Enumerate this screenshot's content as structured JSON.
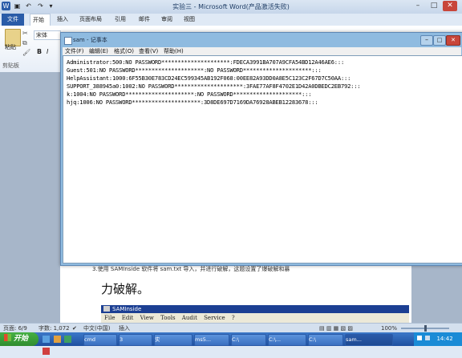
{
  "word": {
    "title": "实验三 - Microsoft Word(产品激活失败)",
    "tabs": [
      "文件",
      "开始",
      "插入",
      "页面布局",
      "引用",
      "邮件",
      "审阅",
      "视图"
    ],
    "clipboard": {
      "paste": "粘贴",
      "group": "剪贴板"
    },
    "font_name": "宋体",
    "format_buttons": [
      "B",
      "I"
    ],
    "doc_line": "3.使用 SAMInside 软件将 sam.txt 导入，并进行破解，这题设置了爆破解和暴",
    "doc_heading": "力破解。",
    "saminside": {
      "title": "SAMInside",
      "menu": [
        "File",
        "Edit",
        "View",
        "Tools",
        "Audit",
        "Service",
        "?"
      ]
    }
  },
  "notepad": {
    "title": "sam - 记事本",
    "menu": [
      "文件(F)",
      "编辑(E)",
      "格式(O)",
      "查看(V)",
      "帮助(H)"
    ],
    "lines": [
      "Administrator:500:NO PASSWORD*********************:FDECA3991BA707A9CFA54BD12A46AE6:::",
      "Guest:501:NO PASSWORD*********************:NO PASSWORD*********************:::",
      "HelpAssistant:1000:6F55B30E783CD24EC599345AB192F068:00EE82A93DD0A8E5C123C2F67D7C50AA:::",
      "SUPPORT_388945a0:1002:NO PASSWORD*********************:3FAE77AF8F4702E1D42A0DBEDC2EB792:::",
      "k:1004:NO PASSWORD*********************:NO PASSWORD*********************:::",
      "hjq:1006:NO PASSWORD*********************:3D8DE697D7169DA76928ABEB12283678:::"
    ]
  },
  "statusbar": {
    "page": "页面: 6/9",
    "words": "字数: 1,072",
    "lang": "中文(中国)",
    "mode": "插入",
    "zoom": "100%"
  },
  "taskbar": {
    "start": "开始",
    "buttons": [
      "cmd",
      "3",
      "实",
      "ms5...",
      "C:\\",
      "C:\\...",
      "C:\\",
      "sam..."
    ],
    "clock": "14:42"
  }
}
